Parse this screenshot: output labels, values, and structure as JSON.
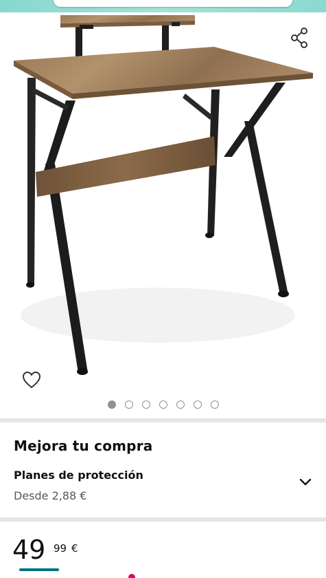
{
  "gallery": {
    "image_alt": "Escritorio de madera con estante elevado y patas negras",
    "share_icon": "share-icon",
    "wishlist_icon": "heart-outline-icon",
    "dots_total": 7,
    "active_dot_index": 0
  },
  "upgrade": {
    "title": "Mejora tu compra",
    "plan_title": "Planes de protección",
    "plan_price": "Desde 2,88 €",
    "expand_icon": "chevron-down-icon"
  },
  "price": {
    "whole": "49",
    "fraction": "99",
    "currency": "€"
  },
  "colors": {
    "accent_teal": "#007185",
    "text": "#0f1111",
    "muted": "#565959",
    "separator": "#e3e6e6",
    "dot": "#8d9296",
    "pink": "#e2006d"
  }
}
